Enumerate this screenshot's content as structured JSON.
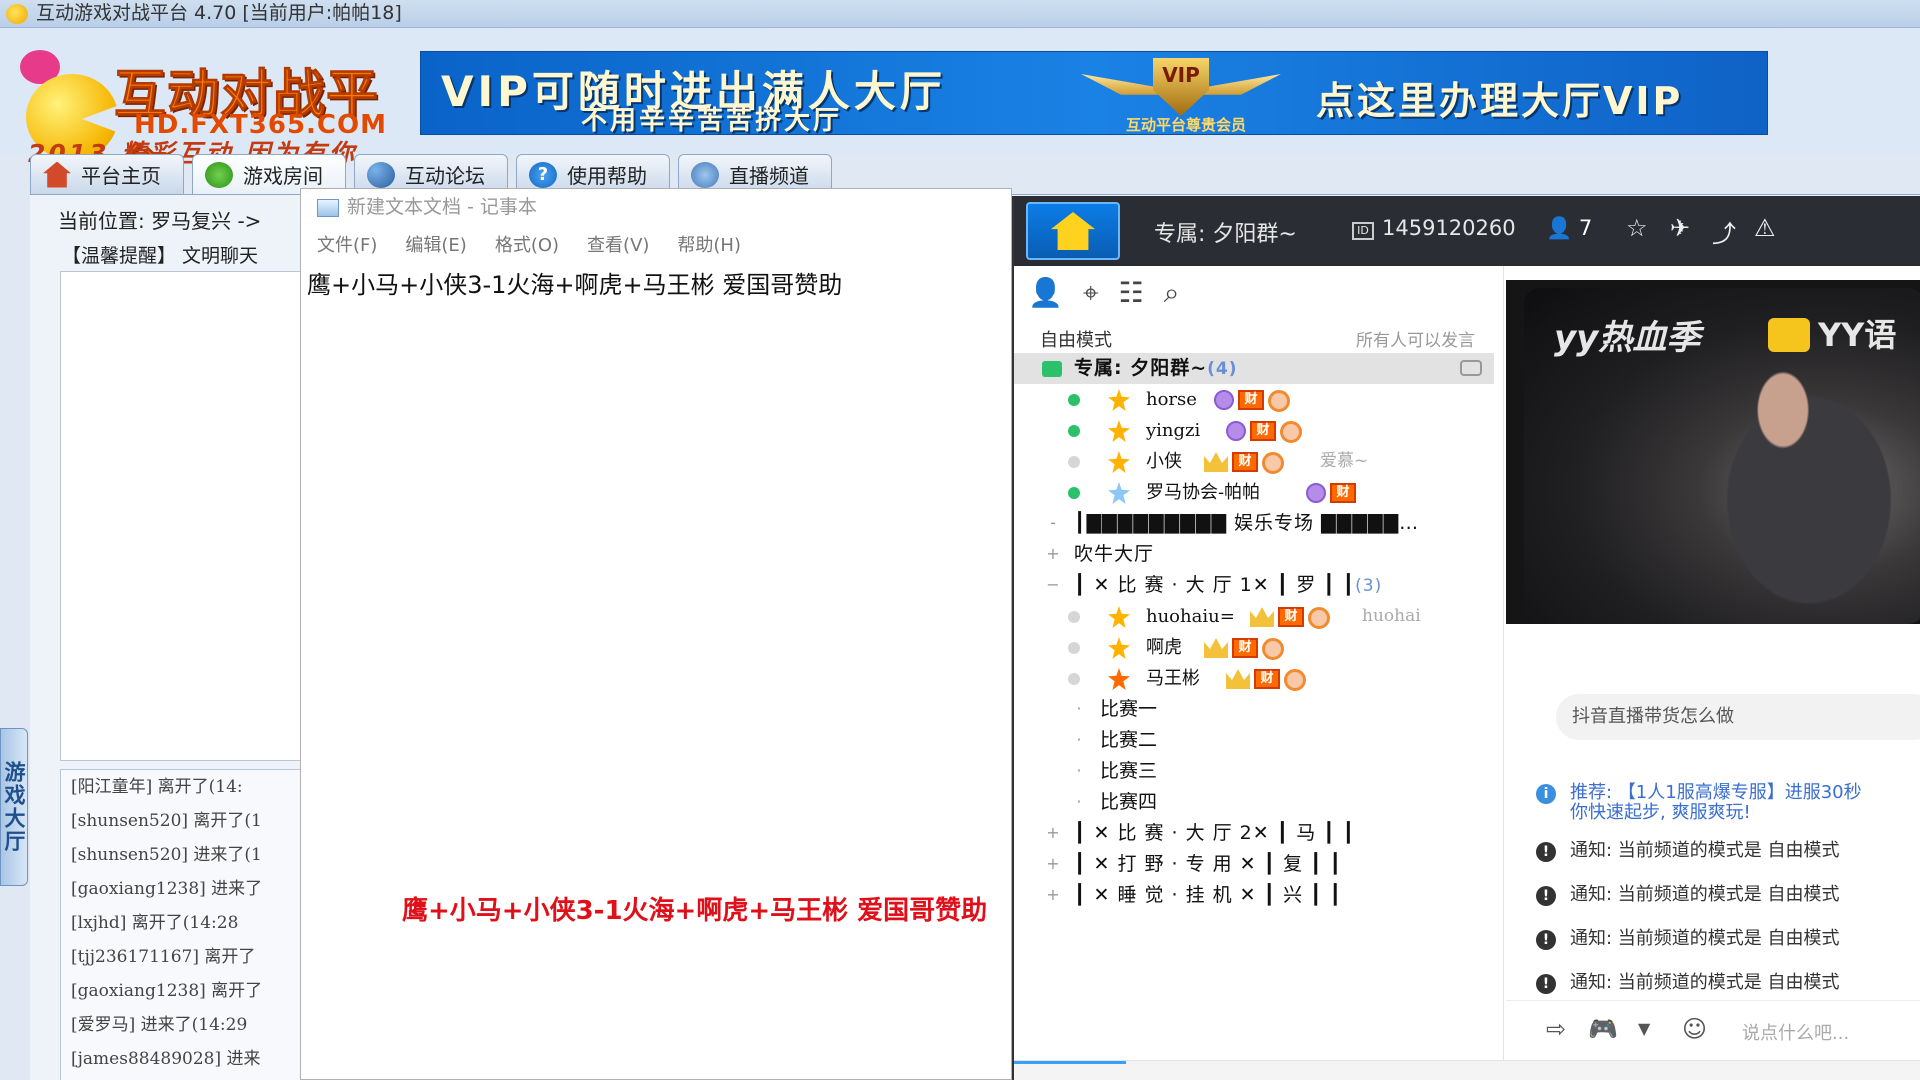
{
  "window": {
    "title": "互动游戏对战平台 4.70 [当前用户:帕帕18]"
  },
  "logo": {
    "name": "互动对战平台",
    "url": "HD.FXT365.COM",
    "slogan": "2013 精彩互动 因为有你"
  },
  "banner": {
    "line1": "VIP可随时进出满人大厅",
    "line2": "不用辛辛苦苦挤大厅",
    "emblem_text": "VIP",
    "emblem_caption": "互动平台尊贵会员",
    "cta": "点这里办理大厅VIP"
  },
  "tabs": [
    {
      "label": "平台主页",
      "icon": "home-icon"
    },
    {
      "label": "游戏房间",
      "icon": "gamepad-icon"
    },
    {
      "label": "互动论坛",
      "icon": "forum-icon"
    },
    {
      "label": "使用帮助",
      "icon": "help-icon"
    },
    {
      "label": "直播频道",
      "icon": "broadcast-icon"
    }
  ],
  "active_tab": "游戏房间",
  "room": {
    "breadcrumb": "当前位置: 罗马复兴 ->",
    "notice": "【温馨提醒】 文明聊天",
    "side_tab": "游戏大厅",
    "log": [
      "[阳江童年] 离开了(14:",
      "[shunsen520] 离开了(1",
      "[shunsen520] 进来了(1",
      "[gaoxiang1238] 进来了",
      "[lxjhd] 离开了(14:28",
      "[tjj236171167] 离开了",
      "[gaoxiang1238] 离开了",
      "[爱罗马] 进来了(14:29",
      "[james88489028] 进来"
    ]
  },
  "notepad": {
    "title": "新建文本文档 - 记事本",
    "menu": [
      "文件(F)",
      "编辑(E)",
      "格式(O)",
      "查看(V)",
      "帮助(H)"
    ],
    "text": "鹰+小马+小侠3-1火海+啊虎+马王彬  爱国哥赞助"
  },
  "overlay_text": "鹰+小马+小侠3-1火海+啊虎+马王彬  爱国哥赞助",
  "yy": {
    "channel_name": "专属: 夕阳群~",
    "channel_id": "1459120260",
    "online_count": "7",
    "mode": "自由模式",
    "mode_note": "所有人可以发言",
    "tree": {
      "root": {
        "label": "专属: 夕阳群~",
        "count": "(4)"
      },
      "root_users": [
        {
          "name": "horse"
        },
        {
          "name": "yingzi"
        },
        {
          "name": "小侠",
          "extra": "爱慕~"
        },
        {
          "name": "罗马协会-帕帕"
        }
      ],
      "channels": [
        {
          "label": "┃▇▇▇▇▇▇▇▇▇  娱乐专场  ▇▇▇▇▇…",
          "expander": "-"
        },
        {
          "label": "吹牛大厅",
          "expander": "+"
        },
        {
          "label": "┃ ✕ 比 赛 · 大 厅 1✕  ┃ 罗  ┃  ┃",
          "count": "(3)",
          "expander": "−"
        }
      ],
      "match_users": [
        {
          "name": "huohaiu=",
          "extra": "huohai"
        },
        {
          "name": "啊虎"
        },
        {
          "name": "马王彬"
        }
      ],
      "subchannels": [
        "比赛一",
        "比赛二",
        "比赛三",
        "比赛四"
      ],
      "more_channels": [
        "┃ ✕ 比 赛 · 大 厅 2✕  ┃ 马  ┃  ┃",
        "┃ ✕ 打 野 · 专 用 ✕  ┃ 复  ┃  ┃",
        "┃ ✕ 睡 觉 · 挂 机 ✕  ┃ 兴  ┃  ┃"
      ]
    },
    "promo": {
      "left": "yy热血季",
      "right": "YY语"
    },
    "search_text": "抖音直播带货怎么做",
    "recommend": {
      "label": "推荐:",
      "text": "【1人1服高爆专服】进服30秒",
      "text2": "你快速起步, 爽服爽玩!"
    },
    "notices": [
      "通知: 当前频道的模式是 自由模式",
      "通知: 当前频道的模式是 自由模式",
      "通知: 当前频道的模式是 自由模式",
      "通知: 当前频道的模式是 自由模式"
    ],
    "input_placeholder": "说点什么吧..."
  }
}
